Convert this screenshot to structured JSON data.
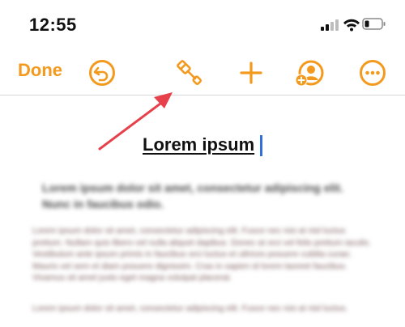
{
  "status": {
    "time": "12:55"
  },
  "toolbar": {
    "done_label": "Done",
    "icons": [
      "undo-icon",
      "format-brush-icon",
      "add-icon",
      "collaborate-icon",
      "more-icon"
    ]
  },
  "document": {
    "title": "Lorem ipsum",
    "subtitle": "Lorem ipsum dolor sit amet, consectetur adipiscing elit. Nunc in faucibus odio.",
    "body": "Lorem ipsum dolor sit amet, consectetur adipiscing elit. Fusce nec nisi at nisl luctus pretium. Nullam quis libero vel nulla aliquet dapibus. Donec at orci vel felis pretium iaculis. Vestibulum ante ipsum primis in faucibus orci luctus et ultrices posuere cubilia curae; Mauris vel sem et diam posuere dignissim. Cras in sapien id lorem laoreet faucibus. Vivamus sit amet justo eget magna volutpat placerat.",
    "body2": "Lorem ipsum dolor sit amet, consectetur adipiscing elit. Fusce nec nisi at nisl luctus."
  },
  "colors": {
    "accent": "#f39a1e",
    "annotation_arrow": "#e8404a",
    "caret": "#2f6fe0"
  }
}
